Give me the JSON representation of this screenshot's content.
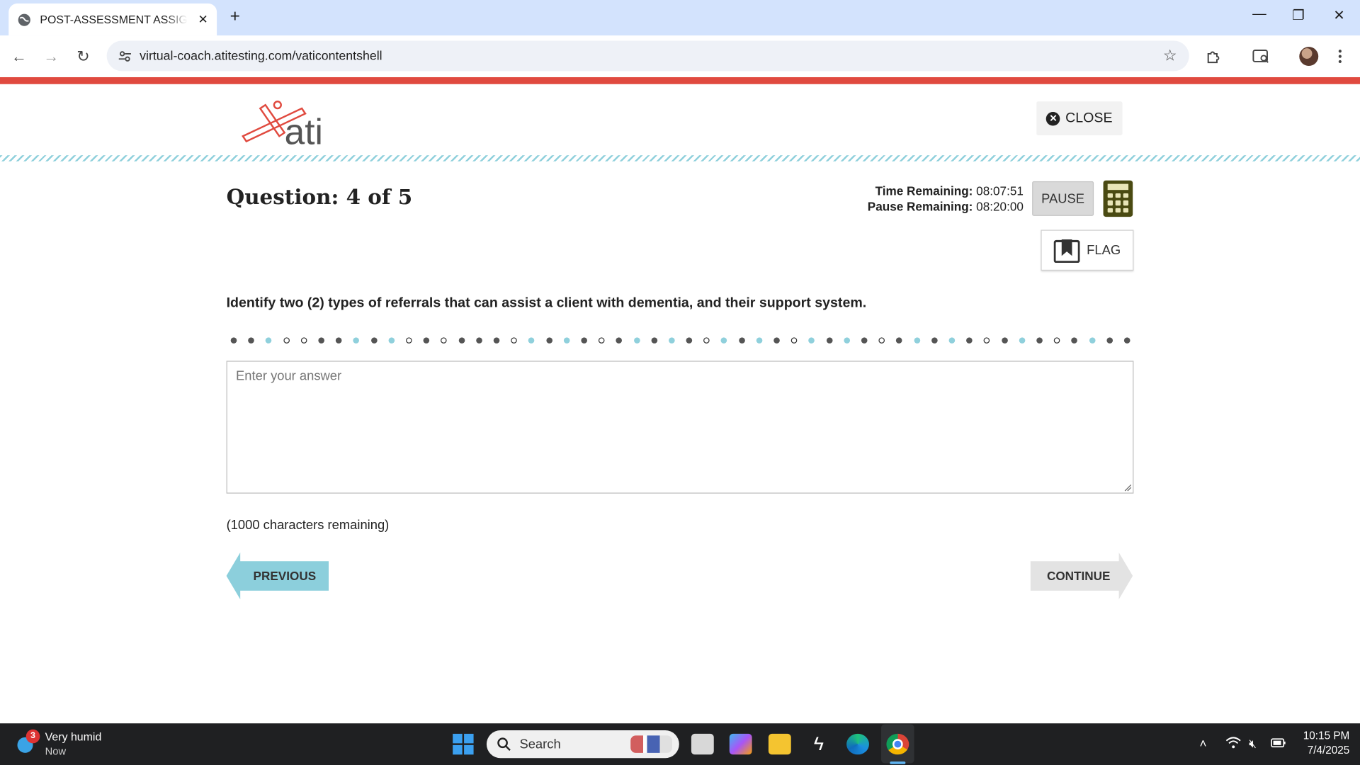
{
  "browser": {
    "tab_title": "POST-ASSESSMENT ASSIGNMENT",
    "url": "virtual-coach.atitesting.com/vaticontentshell"
  },
  "header": {
    "logo_text": "ati",
    "close_label": "CLOSE"
  },
  "question": {
    "title": "Question: 4 of 5",
    "prompt": "Identify two (2) types of referrals that can assist a client with dementia, and their support system.",
    "answer_value": "",
    "answer_placeholder": "Enter your answer",
    "chars_remaining": "(1000 characters remaining)"
  },
  "timers": {
    "time_label": "Time Remaining:",
    "time_value": "08:07:51",
    "pause_label": "Pause Remaining:",
    "pause_value": "08:20:00"
  },
  "controls": {
    "pause_label": "PAUSE",
    "flag_label": "FLAG",
    "previous_label": "PREVIOUS",
    "continue_label": "CONTINUE"
  },
  "colors": {
    "accent_red": "#e04a3f",
    "teal": "#8fd0dc",
    "prev_button": "#8ccfdc",
    "continue_button": "#e3e3e3"
  },
  "taskbar": {
    "weather_badge": "3",
    "weather_title": "Very humid",
    "weather_sub": "Now",
    "search_label": "Search",
    "time": "10:15 PM",
    "date": "7/4/2025"
  }
}
